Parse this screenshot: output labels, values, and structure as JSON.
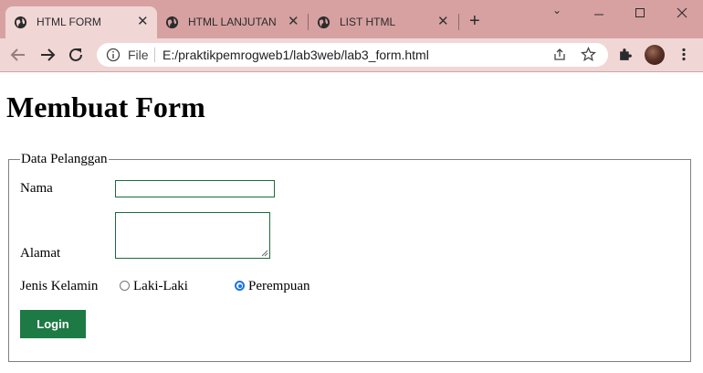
{
  "browser": {
    "tabs": [
      {
        "title": "HTML FORM",
        "active": true
      },
      {
        "title": "HTML LANJUTAN",
        "active": false
      },
      {
        "title": "LIST HTML",
        "active": false
      }
    ],
    "address": {
      "scheme_label": "File",
      "url": "E:/praktikpemrogweb1/lab3web/lab3_form.html"
    },
    "colors": {
      "frame": "#d7a1a1",
      "toolbar": "#f1d6d6",
      "active_tab": "#f1d6d6"
    }
  },
  "page": {
    "heading": "Membuat Form",
    "fieldset": {
      "legend": "Data Pelanggan",
      "nama_label": "Nama",
      "nama_value": "",
      "alamat_label": "Alamat",
      "alamat_value": "",
      "gender_label": "Jenis Kelamin",
      "gender_options": [
        {
          "label": "Laki-Laki",
          "checked": false
        },
        {
          "label": "Perempuan",
          "checked": true
        }
      ],
      "submit_label": "Login"
    },
    "colors": {
      "button_bg": "#1d7a45",
      "input_border": "#1a6b3a",
      "radio_checked": "#1a73e8"
    }
  }
}
